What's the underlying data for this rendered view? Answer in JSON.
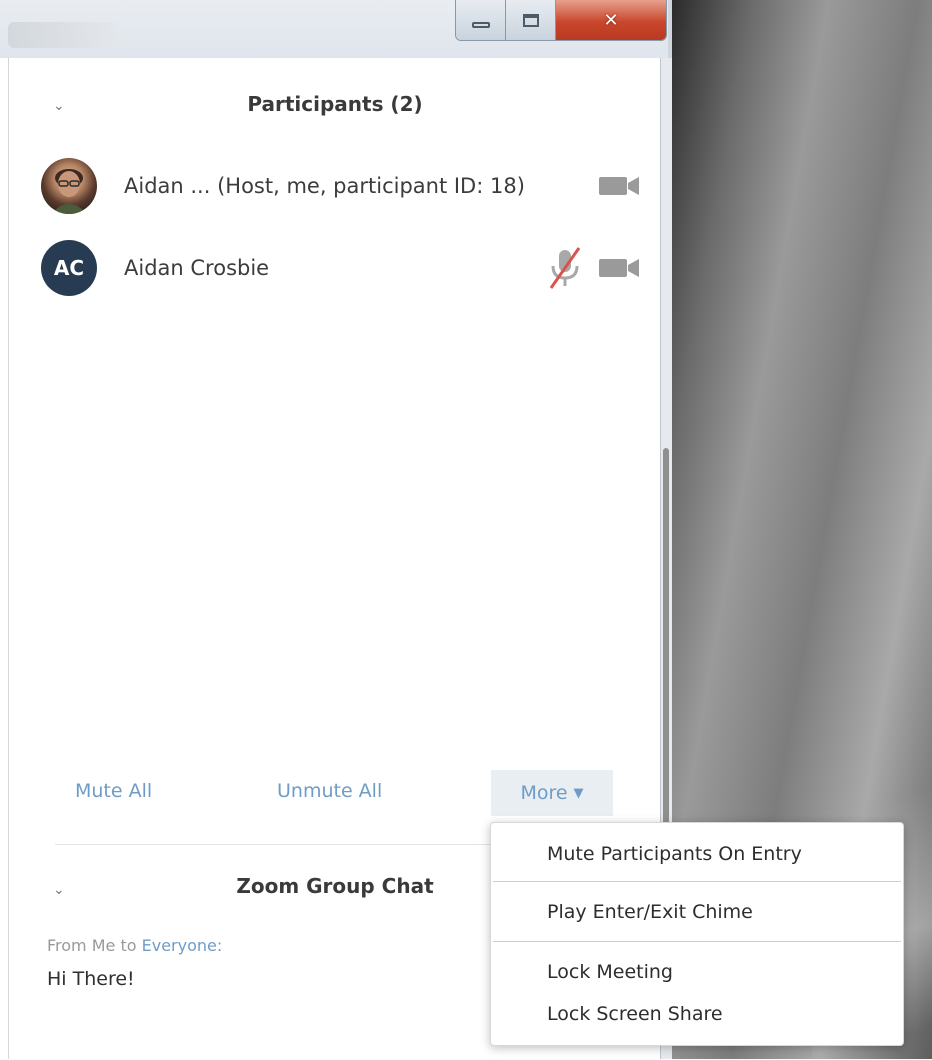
{
  "window": {
    "controls": {
      "minimize": "minimize-icon",
      "maximize": "maximize-icon",
      "close": "close-icon"
    }
  },
  "participants_panel": {
    "title": "Participants (2)",
    "participants": [
      {
        "name": "Aidan ...  (Host, me, participant ID: 18)",
        "avatar": "photo",
        "mic": "none",
        "video": "video-off-icon"
      },
      {
        "name": "Aidan Crosbie",
        "avatar_initials": "AC",
        "mic": "mic-muted-icon",
        "video": "video-off-icon"
      }
    ],
    "actions": {
      "mute_all": "Mute All",
      "unmute_all": "Unmute All",
      "more": "More"
    }
  },
  "chat_panel": {
    "title": "Zoom Group Chat",
    "from_prefix": "From Me to ",
    "to": "Everyone:",
    "message": "Hi There!"
  },
  "more_menu": {
    "items": [
      "Mute Participants On Entry",
      "Play Enter/Exit Chime",
      "Lock Meeting",
      "Lock Screen Share"
    ]
  },
  "colors": {
    "link": "#6f9cc7",
    "avatar_bg": "#273b52",
    "muted_red": "#d9534f",
    "icon_gray": "#9a9a9a"
  }
}
